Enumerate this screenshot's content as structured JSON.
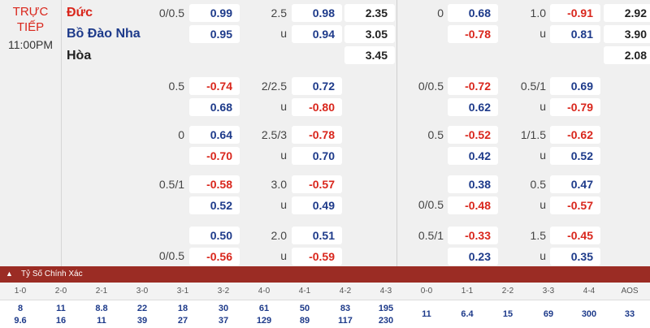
{
  "status": {
    "live": "TRỰC TIẾP",
    "time": "11:00PM"
  },
  "teams": {
    "home": "Đức",
    "away": "Bồ Đào Nha",
    "draw": "Hòa"
  },
  "rows": [
    {
      "l1": "0/0.5",
      "l2": "2.5",
      "l3": "0",
      "l4": "1.0",
      "c1": [
        "0.99",
        "0.95"
      ],
      "c2": [
        "0.98",
        "0.94"
      ],
      "c3": [
        "2.35",
        "3.05",
        "3.45"
      ],
      "c4": [
        "0.68",
        "-0.78"
      ],
      "c5": [
        "-0.91",
        "0.81"
      ],
      "c6": [
        "2.92",
        "3.90",
        "2.08"
      ],
      "u2": "u",
      "u4": "u"
    },
    {
      "l1": "0.5",
      "l2": "2/2.5",
      "l3": "0/0.5",
      "l4": "0.5/1",
      "c1": [
        "-0.74",
        "0.68"
      ],
      "c2": [
        "0.72",
        "-0.80"
      ],
      "c4": [
        "-0.72",
        "0.62"
      ],
      "c5": [
        "0.69",
        "-0.79"
      ],
      "u2": "u",
      "u4": "u"
    },
    {
      "l1": "0",
      "l2": "2.5/3",
      "l3": "0.5",
      "l4": "1/1.5",
      "c1": [
        "0.64",
        "-0.70"
      ],
      "c2": [
        "-0.78",
        "0.70"
      ],
      "c4": [
        "-0.52",
        "0.42"
      ],
      "c5": [
        "-0.62",
        "0.52"
      ],
      "u2": "u",
      "u4": "u"
    },
    {
      "l1": "0.5/1",
      "l2": "3.0",
      "l3": "0/0.5",
      "l4": "0.5",
      "c1": [
        "-0.58",
        "0.52"
      ],
      "c2": [
        "-0.57",
        "0.49"
      ],
      "c4": [
        "0.38",
        "-0.48"
      ],
      "c5": [
        "0.47",
        "-0.57"
      ],
      "u2": "u",
      "u4": "u"
    },
    {
      "l1": "0/0.5",
      "l2": "2.0",
      "l3": "0.5/1",
      "l4": "1.5",
      "c1": [
        "0.50",
        "-0.56"
      ],
      "c2": [
        "0.51",
        "-0.59"
      ],
      "c4": [
        "-0.33",
        "0.23"
      ],
      "c5": [
        "-0.45",
        "0.35"
      ],
      "u2": "u",
      "u4": "u"
    }
  ],
  "correct_score": {
    "title": "Tỷ Số Chính Xác",
    "toggle_icon": "chevron-up-icon",
    "headers": [
      "1-0",
      "2-0",
      "2-1",
      "3-0",
      "3-1",
      "3-2",
      "4-0",
      "4-1",
      "4-2",
      "4-3",
      "0-0",
      "1-1",
      "2-2",
      "3-3",
      "4-4",
      "AOS"
    ],
    "top": [
      "8",
      "11",
      "8.8",
      "22",
      "18",
      "30",
      "61",
      "50",
      "83",
      "195",
      "11",
      "6.4",
      "15",
      "69",
      "300",
      "33"
    ],
    "bottom": [
      "9.6",
      "16",
      "11",
      "39",
      "27",
      "37",
      "129",
      "89",
      "117",
      "230",
      "",
      "",
      "",
      "",
      "",
      ""
    ]
  },
  "colors": {
    "positive": "#1d3a8a",
    "negative": "#d9261c",
    "bar": "#9b2c24"
  }
}
